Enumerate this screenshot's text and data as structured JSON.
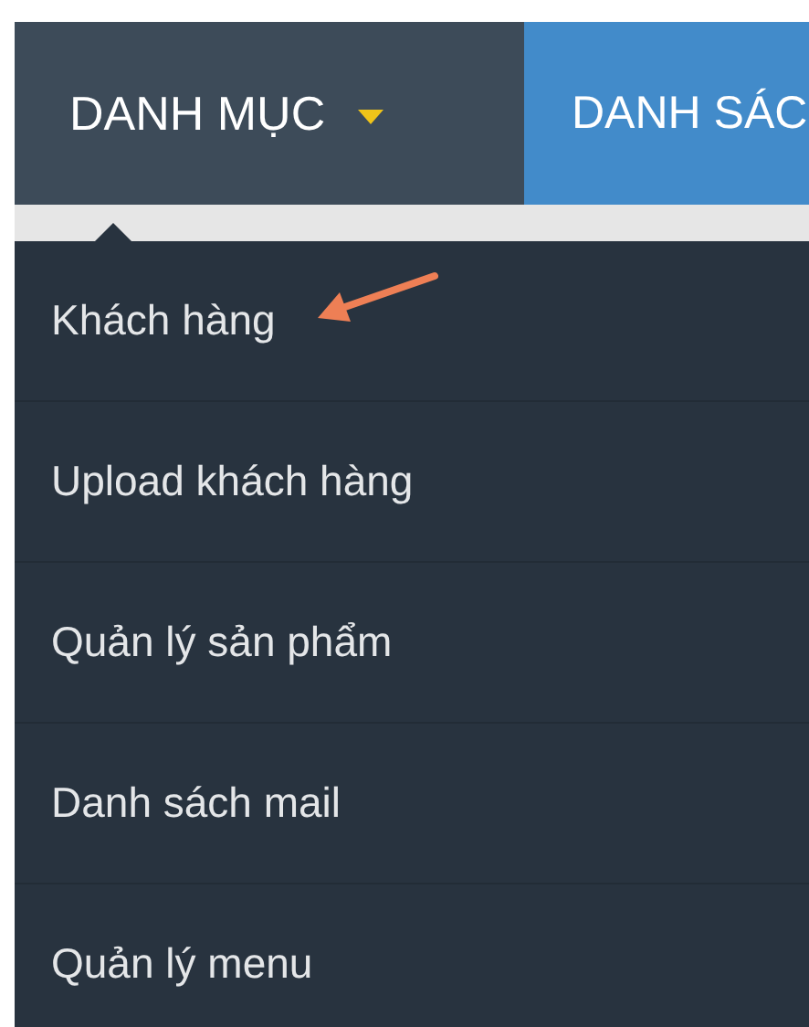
{
  "nav": [
    {
      "label": "DANH MỤC",
      "kind": "dropdown",
      "expanded": true
    },
    {
      "label": "DANH SÁC",
      "kind": "link",
      "expanded": false
    }
  ],
  "menu": {
    "items": [
      {
        "label": "Khách hàng",
        "annotated": true
      },
      {
        "label": "Upload khách hàng",
        "annotated": false
      },
      {
        "label": "Quản lý sản phẩm",
        "annotated": false
      },
      {
        "label": "Danh sách mail",
        "annotated": false
      },
      {
        "label": "Quản lý menu",
        "annotated": false
      }
    ]
  }
}
